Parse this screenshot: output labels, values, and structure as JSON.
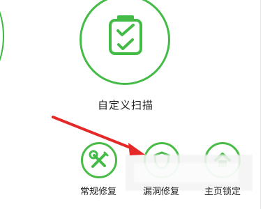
{
  "main_feature": {
    "label": "自定义扫描",
    "icon": "checklist-icon"
  },
  "bottom_features": [
    {
      "label": "常规修复",
      "icon": "wrench-screwdriver-icon"
    },
    {
      "label": "漏洞修复",
      "icon": "shield-icon"
    },
    {
      "label": "主页锁定",
      "icon": "house-icon"
    }
  ],
  "colors": {
    "accent": "#45bb47",
    "arrow": "#e52828"
  }
}
